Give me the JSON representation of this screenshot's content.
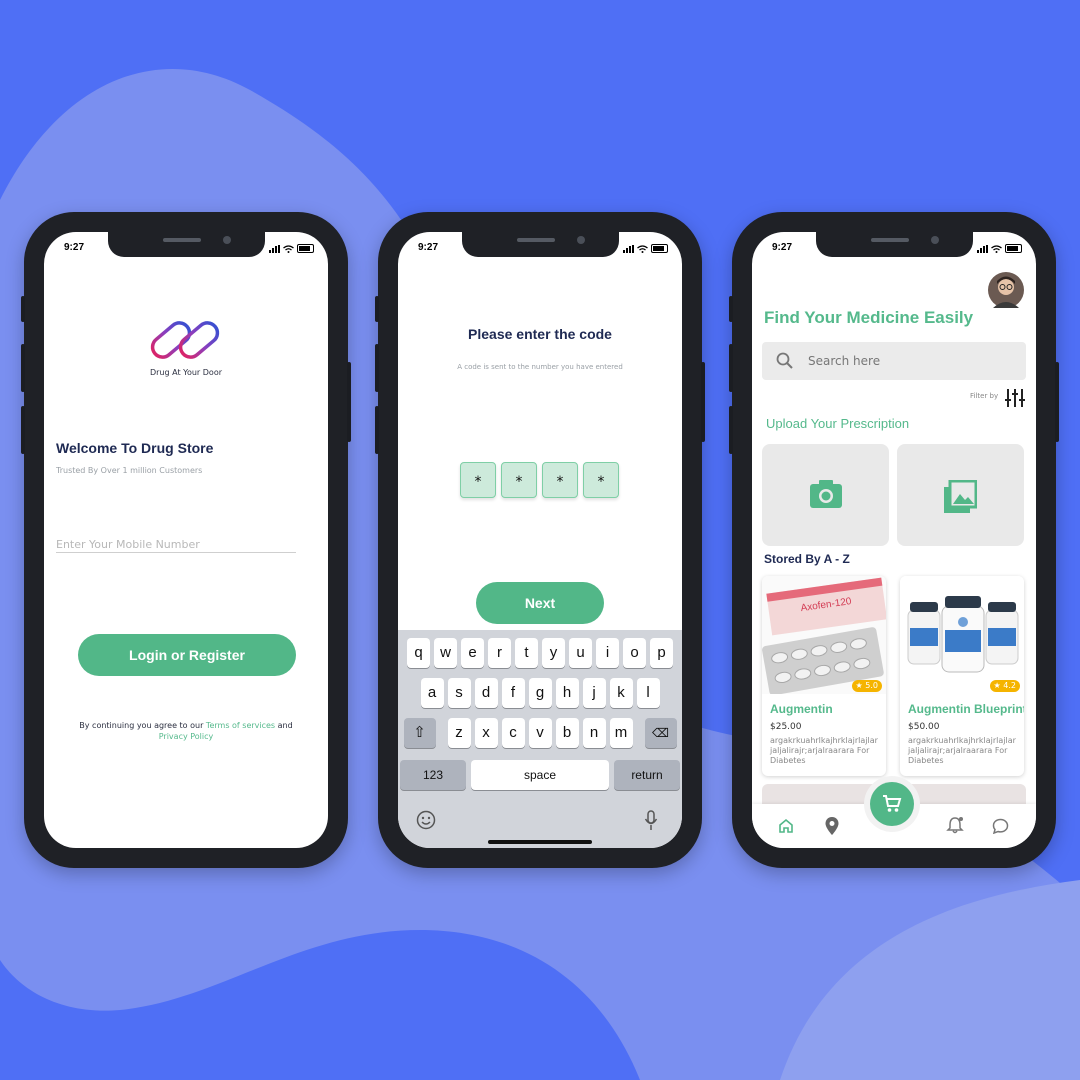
{
  "colors": {
    "background": "#4f6ff5",
    "blob": "#7a8ff0",
    "accent": "#52b788",
    "phone": "#1f2126",
    "title": "#1f2a53"
  },
  "status_time": "9:27",
  "login_screen": {
    "logo_caption": "Drug At Your Door",
    "title": "Welcome To Drug Store",
    "subtitle": "Trusted By Over 1 million Customers",
    "mobile_placeholder": "Enter Your Mobile Number",
    "button_label": "Login or Register",
    "terms_prefix": "By continuing you agree to our",
    "terms_link": "Terms of services",
    "terms_and": "and",
    "privacy_link": "Privacy Policy"
  },
  "code_screen": {
    "title": "Please enter the code",
    "subtitle": "A code is sent to the number you have entered",
    "code_digits": [
      "*",
      "*",
      "*",
      "*"
    ],
    "button_label": "Next",
    "keyboard": {
      "row1": [
        "q",
        "w",
        "e",
        "r",
        "t",
        "y",
        "u",
        "i",
        "o",
        "p"
      ],
      "row2": [
        "a",
        "s",
        "d",
        "f",
        "g",
        "h",
        "j",
        "k",
        "l"
      ],
      "row3": [
        "z",
        "x",
        "c",
        "v",
        "b",
        "n",
        "m"
      ],
      "numbers_key": "123",
      "space_key": "space",
      "return_key": "return"
    }
  },
  "home_screen": {
    "title": "Find Your Medicine Easily",
    "search_placeholder": "Search  here",
    "filter_label": "Filter by",
    "upload_title": "Upload Your Prescription",
    "section_title": "Stored By A - Z",
    "products": [
      {
        "name": "Augmentin",
        "price": "$25.00",
        "description": "argakrkuahrlkajhrklajrlajlar jaljalirajr;arjalraarara For Diabetes",
        "rating": "5.0",
        "icon": "tablet-pack-image"
      },
      {
        "name": "Augmentin Blueprint",
        "price": "$50.00",
        "description": "argakrkuahrlkajhrklajrlajlar jaljalirajr;arjalraarara For Diabetes",
        "rating": "4.2",
        "icon": "supplement-bottles-image"
      }
    ],
    "nav_icons": [
      "home-icon",
      "location-pin-icon",
      "cart-icon",
      "bell-icon",
      "chat-icon"
    ]
  }
}
